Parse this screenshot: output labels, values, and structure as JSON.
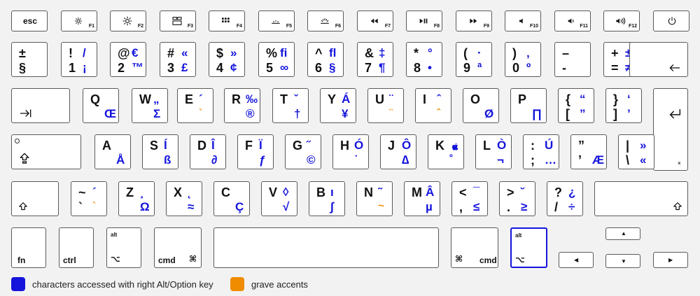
{
  "frow": [
    {
      "id": "esc",
      "label": "esc"
    },
    {
      "id": "f1",
      "num": "F1",
      "icon": "brightness-low-icon"
    },
    {
      "id": "f2",
      "num": "F2",
      "icon": "brightness-high-icon"
    },
    {
      "id": "f3",
      "num": "F3",
      "icon": "mission-control-icon"
    },
    {
      "id": "f4",
      "num": "F4",
      "icon": "launchpad-icon"
    },
    {
      "id": "f5",
      "num": "F5",
      "icon": "kbd-light-down-icon"
    },
    {
      "id": "f6",
      "num": "F6",
      "icon": "kbd-light-up-icon"
    },
    {
      "id": "f7",
      "num": "F7",
      "icon": "rewind-icon"
    },
    {
      "id": "f8",
      "num": "F8",
      "icon": "play-pause-icon"
    },
    {
      "id": "f9",
      "num": "F9",
      "icon": "fast-forward-icon"
    },
    {
      "id": "f10",
      "num": "F10",
      "icon": "mute-icon"
    },
    {
      "id": "f11",
      "num": "F11",
      "icon": "volume-down-icon"
    },
    {
      "id": "f12",
      "num": "F12",
      "icon": "volume-up-icon"
    },
    {
      "id": "power",
      "icon": "power-icon"
    }
  ],
  "num_row": [
    {
      "id": "section",
      "tl": "±",
      "bl": "§"
    },
    {
      "id": "1",
      "tl": "!",
      "bl": "1",
      "tr": "/",
      "br": "¡"
    },
    {
      "id": "2",
      "tl": "@",
      "bl": "2",
      "tr": "€",
      "br": "™"
    },
    {
      "id": "3",
      "tl": "#",
      "bl": "3",
      "tr": "«",
      "br": "£"
    },
    {
      "id": "4",
      "tl": "$",
      "bl": "4",
      "tr": "»",
      "br": "¢"
    },
    {
      "id": "5",
      "tl": "%",
      "bl": "5",
      "tr": "ﬁ",
      "br": "∞"
    },
    {
      "id": "6",
      "tl": "^",
      "bl": "6",
      "tr": "ﬂ",
      "br": "§"
    },
    {
      "id": "7",
      "tl": "&",
      "bl": "7",
      "tr": "‡",
      "br": "¶"
    },
    {
      "id": "8",
      "tl": "*",
      "bl": "8",
      "tr": "°",
      "br": "•"
    },
    {
      "id": "9",
      "tl": "(",
      "bl": "9",
      "tr": "·",
      "br": "ª"
    },
    {
      "id": "0",
      "tl": ")",
      "bl": "0",
      "tr": "‚",
      "br": "º"
    },
    {
      "id": "minus",
      "tl": "–",
      "bl": "-"
    },
    {
      "id": "equal",
      "tl": "+",
      "bl": "=",
      "tr": "±",
      "br": "≠"
    },
    {
      "id": "backspace",
      "icon": "backspace-icon"
    }
  ],
  "q_row": [
    {
      "id": "tab",
      "icon": "tab-icon"
    },
    {
      "id": "q",
      "tl": "Q",
      "br": "Œ"
    },
    {
      "id": "w",
      "tl": "W",
      "tr": "„",
      "br": "Σ"
    },
    {
      "id": "e",
      "tl": "E",
      "tr": "´",
      "grave": "`"
    },
    {
      "id": "r",
      "tl": "R",
      "tr": "‰",
      "br": "®"
    },
    {
      "id": "t",
      "tl": "T",
      "tr": "ˇ",
      "br": "†"
    },
    {
      "id": "y",
      "tl": "Y",
      "tr": "Á",
      "br": "¥"
    },
    {
      "id": "u",
      "tl": "U",
      "tr": "¨",
      "grave": "¨"
    },
    {
      "id": "i",
      "tl": "I",
      "tr": "ˆ",
      "grave": "ˆ"
    },
    {
      "id": "o",
      "tl": "O",
      "br": "Ø"
    },
    {
      "id": "p",
      "tl": "P",
      "br": "∏"
    },
    {
      "id": "lbracket",
      "tl": "{",
      "bl": "[",
      "tr": "“",
      "br": "”"
    },
    {
      "id": "rbracket",
      "tl": "}",
      "bl": "]",
      "tr": "‘",
      "br": "’"
    },
    {
      "id": "return",
      "icon": "return-icon"
    }
  ],
  "a_row": [
    {
      "id": "capslock",
      "icon": "caps-lock-icon"
    },
    {
      "id": "a",
      "tl": "A",
      "br": "Å"
    },
    {
      "id": "s",
      "tl": "S",
      "tr": "Í",
      "br": "ß"
    },
    {
      "id": "d",
      "tl": "D",
      "tr": "Î",
      "br": "∂"
    },
    {
      "id": "f",
      "tl": "F",
      "tr": "Ï",
      "br": "ƒ"
    },
    {
      "id": "g",
      "tl": "G",
      "tr": "˝",
      "br": "©"
    },
    {
      "id": "h",
      "tl": "H",
      "tr": "Ó",
      "br": "˙"
    },
    {
      "id": "j",
      "tl": "J",
      "tr": "Ô",
      "br": "∆"
    },
    {
      "id": "k",
      "tl": "K",
      "tr": "",
      "br": "˚"
    },
    {
      "id": "l",
      "tl": "L",
      "tr": "Ò",
      "br": "¬"
    },
    {
      "id": "semicolon",
      "tl": ":",
      "bl": ";",
      "tr": "Ú",
      "br": "…"
    },
    {
      "id": "quote",
      "tl": "”",
      "bl": "’",
      "br": "Æ"
    },
    {
      "id": "backslash",
      "tl": "|",
      "bl": "\\",
      "tr": "»",
      "br": "«"
    }
  ],
  "z_row": [
    {
      "id": "lshift",
      "icon": "shift-icon"
    },
    {
      "id": "grave",
      "tl": "~",
      "bl": "`",
      "tr": "´",
      "grave": "`"
    },
    {
      "id": "z",
      "tl": "Z",
      "tr": "¸",
      "br": "Ω"
    },
    {
      "id": "x",
      "tl": "X",
      "tr": "˛",
      "br": "≈"
    },
    {
      "id": "c",
      "tl": "C",
      "br": "Ç"
    },
    {
      "id": "v",
      "tl": "V",
      "tr": "◊",
      "br": "√"
    },
    {
      "id": "b",
      "tl": "B",
      "tr": "ı",
      "br": "∫"
    },
    {
      "id": "n",
      "tl": "N",
      "tr": "˜",
      "grave": "~"
    },
    {
      "id": "m",
      "tl": "M",
      "tr": "Â",
      "br": "µ"
    },
    {
      "id": "comma",
      "tl": "<",
      "bl": ",",
      "tr": "¯",
      "br": "≤"
    },
    {
      "id": "period",
      "tl": ">",
      "bl": ".",
      "tr": "˘",
      "br": "≥"
    },
    {
      "id": "slash",
      "tl": "?",
      "bl": "/",
      "tr": "¿",
      "br": "÷"
    },
    {
      "id": "rshift",
      "icon": "shift-icon"
    }
  ],
  "bottom": {
    "fn": "fn",
    "ctrl": "ctrl",
    "alt": "alt",
    "cmd": "cmd",
    "option_symbol": "⌥",
    "cmd_symbol": "⌘"
  },
  "arrows": {
    "up": "▲",
    "down": "▼",
    "left": "◀",
    "right": "▶"
  },
  "legend": [
    {
      "label": "characters accessed with right Alt/Option key",
      "color": "#1414dc"
    },
    {
      "label": "grave accents",
      "color": "#f08c00"
    }
  ],
  "colors": {
    "alt": "#1414dc",
    "grave": "#f08c00"
  }
}
